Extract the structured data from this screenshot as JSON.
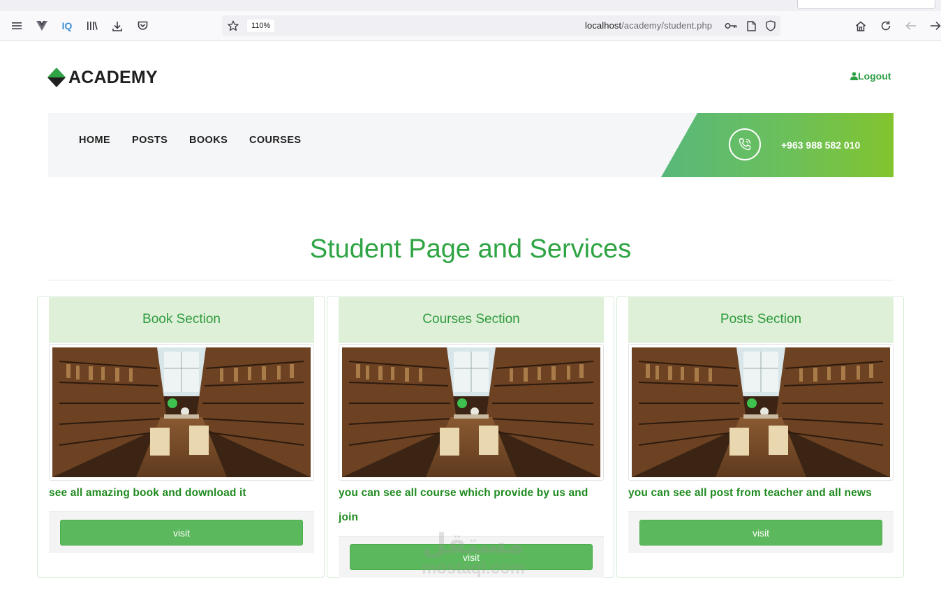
{
  "browser": {
    "zoom": "110%",
    "url_host": "localhost",
    "url_path": "/academy/student.php"
  },
  "header": {
    "logo_text": "ACADEMY",
    "logout_label": "Logout"
  },
  "nav": {
    "items": [
      {
        "label": "HOME"
      },
      {
        "label": "POSTS"
      },
      {
        "label": "BOOKS"
      },
      {
        "label": "COURSES"
      }
    ],
    "phone": "+963 988 582 010"
  },
  "main": {
    "title": "Student Page and Services",
    "cards": [
      {
        "title": "Book Section",
        "description": "see all amazing book and download it",
        "button": "visit"
      },
      {
        "title": "Courses Section",
        "description": "you can see all course which provide by us and join",
        "button": "visit"
      },
      {
        "title": "Posts Section",
        "description": "you can see all post from teacher and all news",
        "button": "visit"
      }
    ]
  },
  "watermark": {
    "arabic": "مستقل",
    "latin": "mostaql.com"
  },
  "colors": {
    "brand_green": "#2fa444",
    "button_green": "#5cb85c",
    "panel_header": "#dff0d8"
  }
}
